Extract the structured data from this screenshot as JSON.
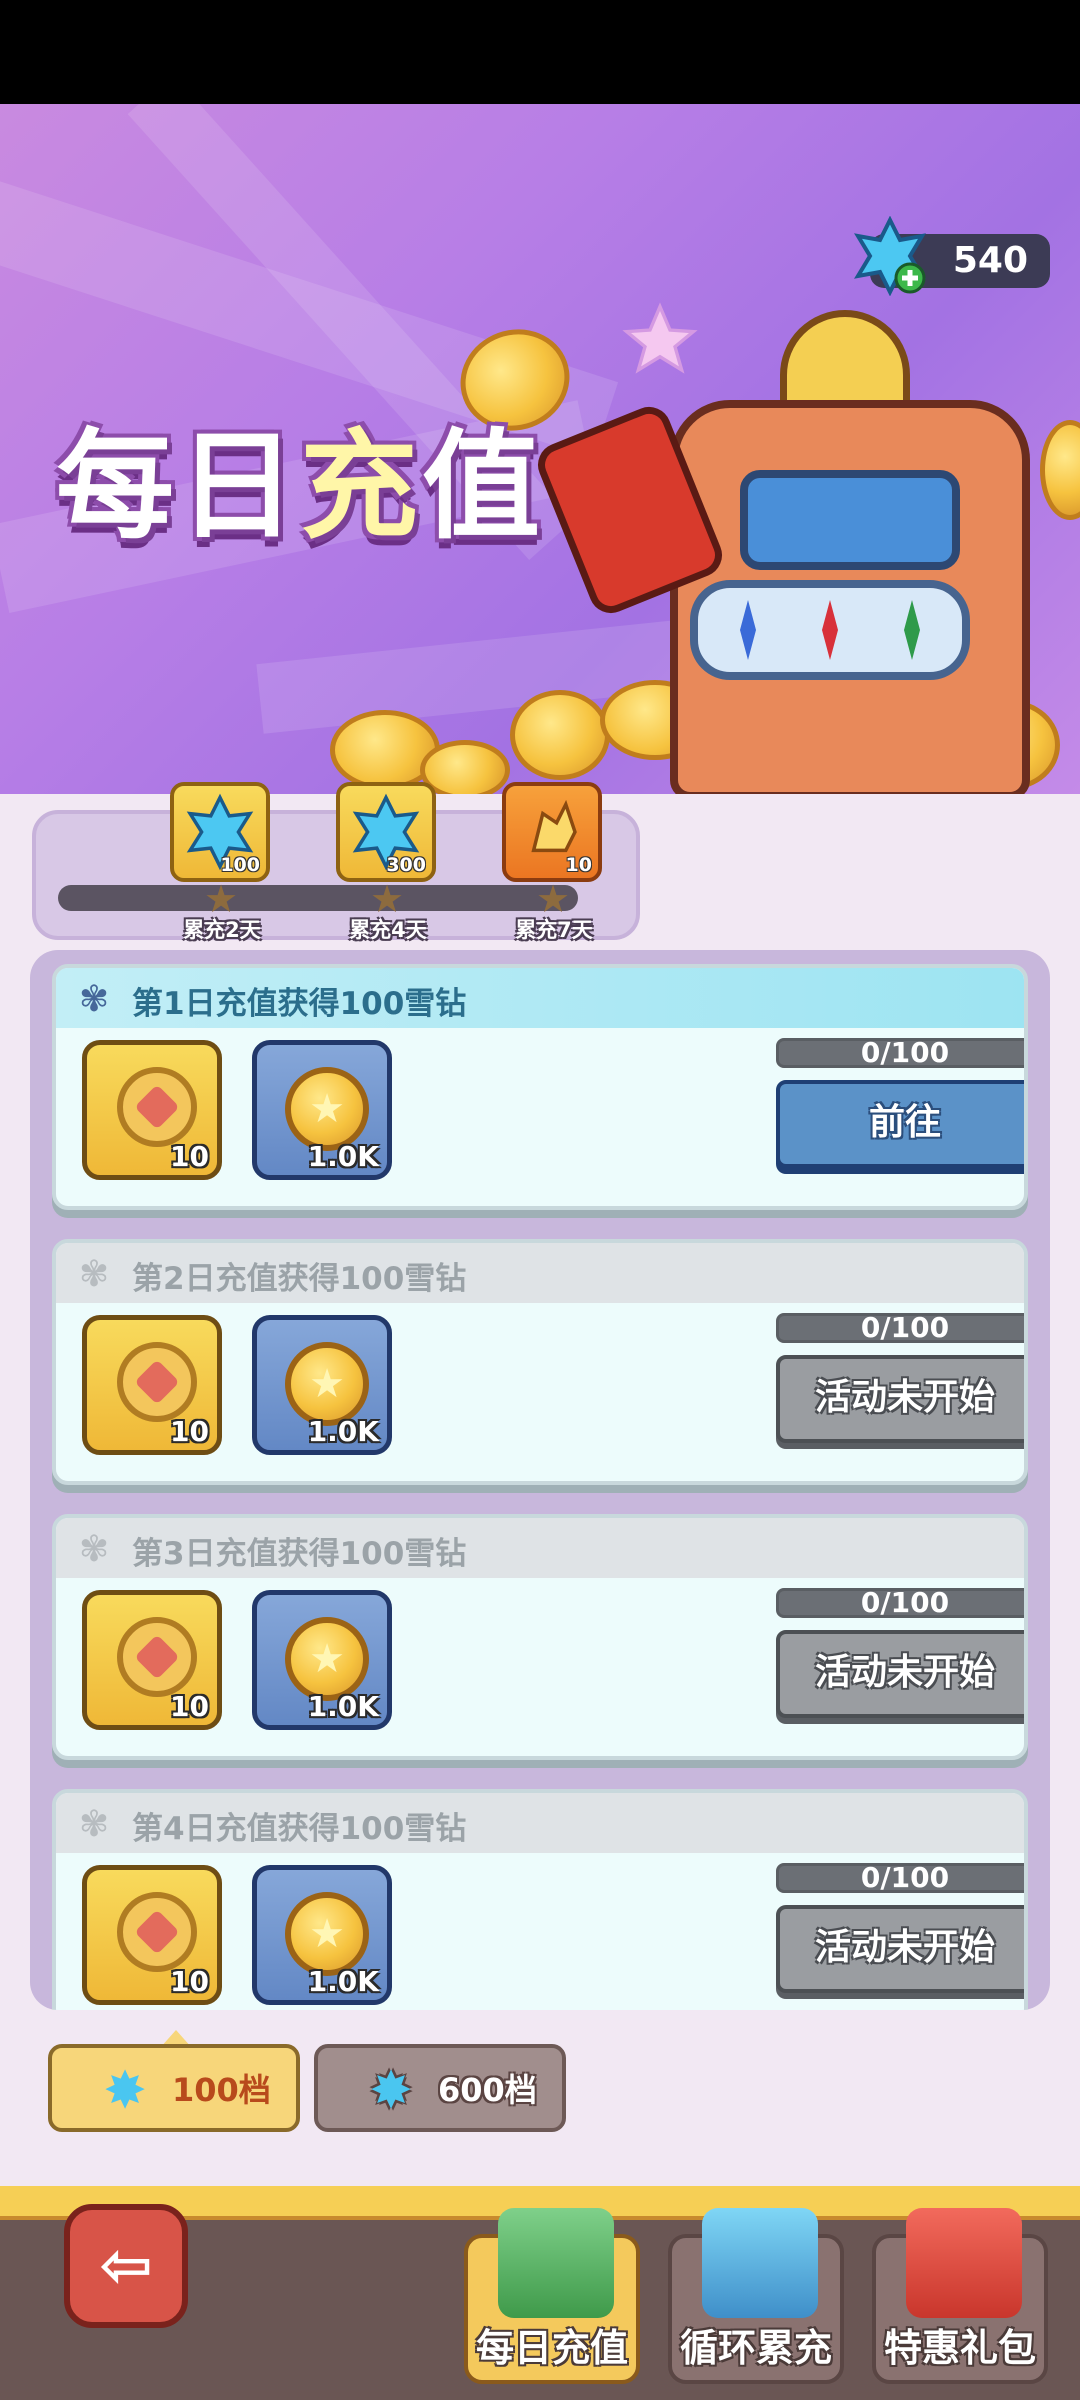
{
  "banner": {
    "title_part1": "每日",
    "title_part2": "充",
    "title_part3": "值",
    "currency_value": "540"
  },
  "milestones": [
    {
      "count": "100",
      "label": "累充2天",
      "icon": "snow-diamond-icon"
    },
    {
      "count": "300",
      "label": "累充4天",
      "icon": "snow-diamond-icon"
    },
    {
      "count": "10",
      "label": "累充7天",
      "icon": "crystal-icon"
    }
  ],
  "tasks": [
    {
      "title": "第1日充值获得100雪钻",
      "progress": "0/100",
      "button": "前往",
      "reward1_count": "10",
      "reward2_count": "1.0K"
    },
    {
      "title": "第2日充值获得100雪钻",
      "progress": "0/100",
      "button": "活动未开始",
      "reward1_count": "10",
      "reward2_count": "1.0K"
    },
    {
      "title": "第3日充值获得100雪钻",
      "progress": "0/100",
      "button": "活动未开始",
      "reward1_count": "10",
      "reward2_count": "1.0K"
    },
    {
      "title": "第4日充值获得100雪钻",
      "progress": "0/100",
      "button": "活动未开始",
      "reward1_count": "10",
      "reward2_count": "1.0K"
    }
  ],
  "tiers": [
    {
      "label": "100档"
    },
    {
      "label": "600档"
    }
  ],
  "nav": [
    {
      "label": "每日充值"
    },
    {
      "label": "循环累充"
    },
    {
      "label": "特惠礼包"
    }
  ],
  "colors": {
    "banner": "#b77ee6",
    "panel": "#c8b7dc",
    "go_button": "#5b92c8",
    "disabled_button": "#9a9da1"
  }
}
